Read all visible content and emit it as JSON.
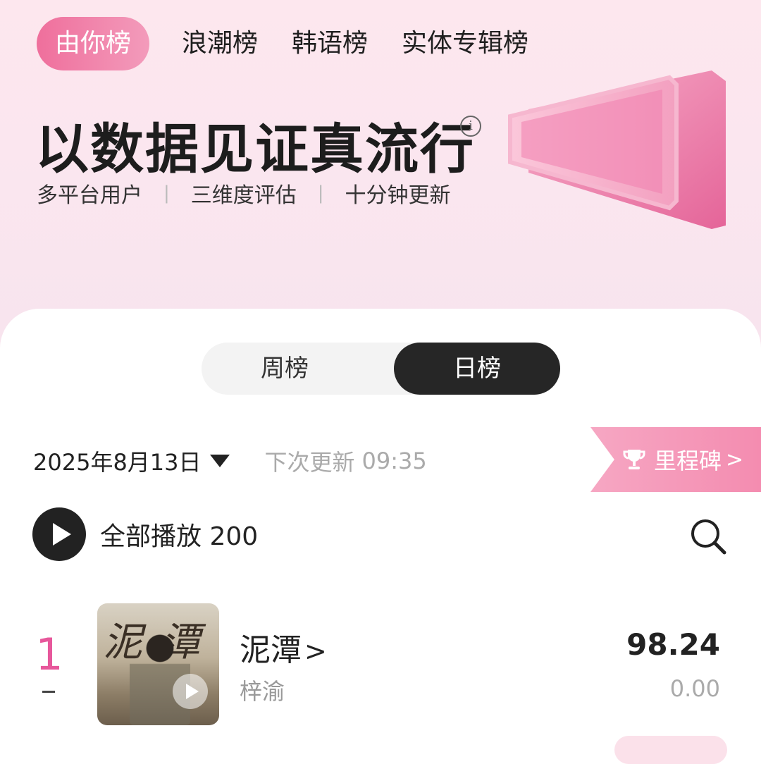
{
  "tabs": [
    {
      "label": "由你榜",
      "active": true
    },
    {
      "label": "浪潮榜",
      "active": false
    },
    {
      "label": "韩语榜",
      "active": false
    },
    {
      "label": "实体专辑榜",
      "active": false
    }
  ],
  "hero": {
    "title": "以数据见证真流行",
    "info_icon": "info-icon",
    "features": [
      "多平台用户",
      "三维度评估",
      "十分钟更新"
    ],
    "separator": "|"
  },
  "segment": {
    "week": "周榜",
    "day": "日榜",
    "selected": "day"
  },
  "chart_meta": {
    "date": "2025年8月13日",
    "next_update_label": "下次更新",
    "next_update_time": "09:35",
    "milestone_label": "里程碑",
    "milestone_chevron": ">"
  },
  "play_all": {
    "label": "全部播放 200"
  },
  "songs": [
    {
      "rank": "1",
      "rank_change": "–",
      "title": "泥潭",
      "title_chevron": ">",
      "artist": "梓渝",
      "score": "98.24",
      "delta": "0.00",
      "cover_text": "泥潭"
    }
  ],
  "colors": {
    "accent": "#ef6f9c",
    "rank": "#e7579b",
    "dark": "#262626"
  }
}
